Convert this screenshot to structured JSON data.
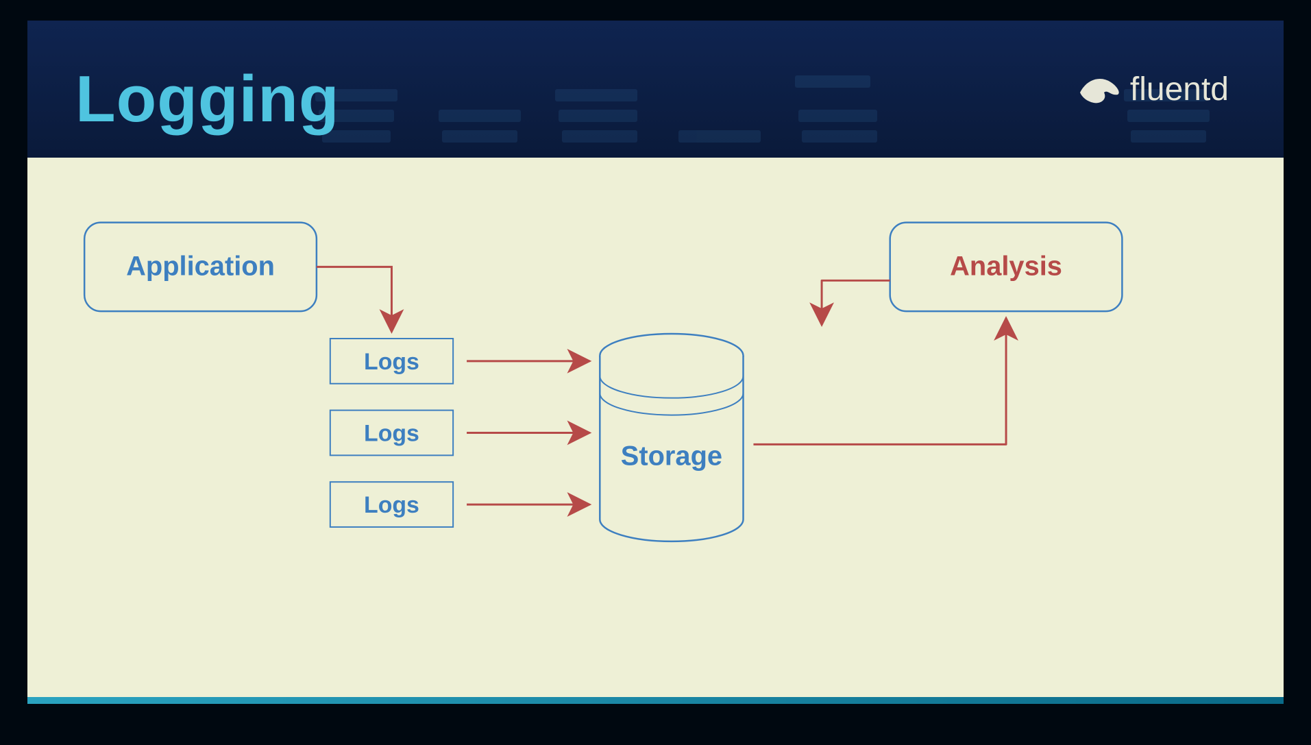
{
  "title": "Logging",
  "logo_text": "fluentd",
  "diagram": {
    "application_label": "Application",
    "logs_label_1": "Logs",
    "logs_label_2": "Logs",
    "logs_label_3": "Logs",
    "storage_label": "Storage",
    "analysis_label": "Analysis"
  }
}
